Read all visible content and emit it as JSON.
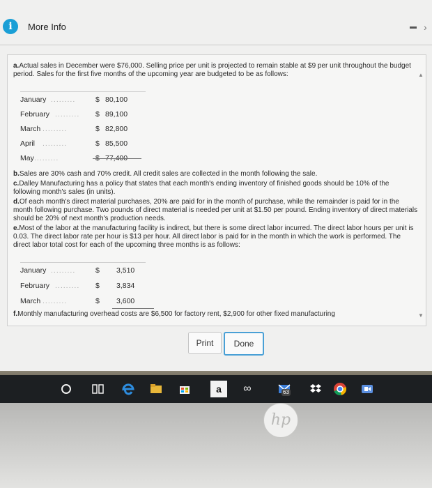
{
  "dialog": {
    "title": "More Info",
    "info_icon": "i",
    "print_label": "Print",
    "done_label": "Done"
  },
  "content": {
    "a_label": "a.",
    "a_text": "Actual sales in December were $76,000. Selling price per unit is projected to remain stable at $9 per unit throughout the budget period. Sales for the first five months of the upcoming year are budgeted to be as follows:",
    "sales_table": [
      {
        "month": "January",
        "currency": "$",
        "amount": "80,100"
      },
      {
        "month": "February",
        "currency": "$",
        "amount": "89,100"
      },
      {
        "month": "March",
        "currency": "$",
        "amount": "82,800"
      },
      {
        "month": "April",
        "currency": "$",
        "amount": "85,500"
      },
      {
        "month": "May",
        "currency": "$",
        "amount": "77,400"
      }
    ],
    "b_label": "b.",
    "b_text": "Sales are 30% cash and 70% credit. All credit sales are collected in the month following the sale.",
    "c_label": "c.",
    "c_text": "Dalley Manufacturing has a policy that states that each month's ending inventory of finished goods should be 10% of the following month's sales (in units).",
    "d_label": "d.",
    "d_text": "Of each month's direct material purchases, 20% are paid for in the month of purchase, while the remainder is paid for in the month following purchase. Two pounds of direct material is needed per unit at $1.50 per pound. Ending inventory of direct materials should be 20% of next month's production needs.",
    "e_label": "e.",
    "e_text": "Most of the labor at the manufacturing facility is indirect, but there is some direct labor incurred. The direct labor hours per unit is 0.03. The direct labor rate per hour is $13 per hour. All direct labor is paid for in the month in which the work is performed. The direct labor total cost for each of the upcoming three months is as follows:",
    "labor_table": [
      {
        "month": "January",
        "currency": "$",
        "amount": "3,510"
      },
      {
        "month": "February",
        "currency": "$",
        "amount": "3,834"
      },
      {
        "month": "March",
        "currency": "$",
        "amount": "3,600"
      }
    ],
    "f_label": "f.",
    "f_text": "Monthly manufacturing overhead costs are $6,500 for factory rent, $2,900 for other fixed manufacturing"
  },
  "taskbar": {
    "amazon_glyph": "a",
    "badge_count": "63",
    "laptop_logo": "hp"
  }
}
